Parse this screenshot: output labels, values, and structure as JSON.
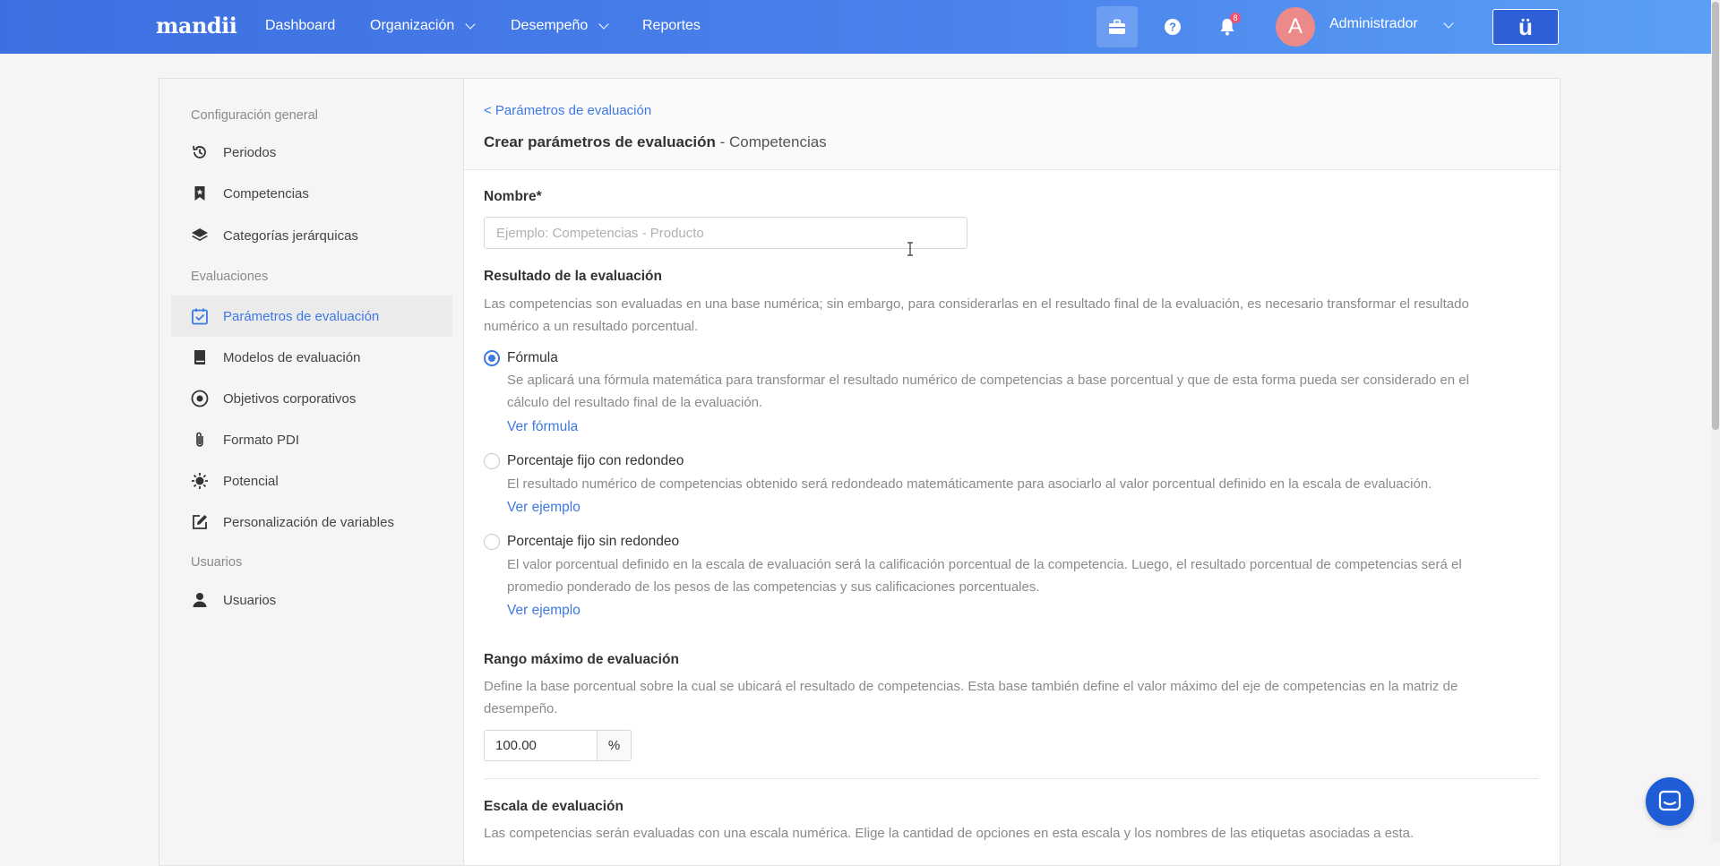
{
  "app": {
    "logo": "mandii",
    "nav": {
      "dashboard": "Dashboard",
      "organizacion": "Organización",
      "desempeno": "Desempeño",
      "reportes": "Reportes"
    },
    "notifications_count": "8",
    "user": {
      "initial": "A",
      "name": "Administrador"
    },
    "brand_button": "ü"
  },
  "sidebar": {
    "groups": {
      "general": "Configuración general",
      "evaluaciones": "Evaluaciones",
      "usuarios": "Usuarios"
    },
    "items": [
      {
        "label": "Periodos",
        "icon": "history-icon"
      },
      {
        "label": "Competencias",
        "icon": "bookmark-icon"
      },
      {
        "label": "Categorías jerárquicas",
        "icon": "layers-icon"
      },
      {
        "label": "Parámetros de evaluación",
        "icon": "calendar-check-icon",
        "active": true
      },
      {
        "label": "Modelos de evaluación",
        "icon": "book-icon"
      },
      {
        "label": "Objetivos corporativos",
        "icon": "target-icon"
      },
      {
        "label": "Formato PDI",
        "icon": "paperclip-icon"
      },
      {
        "label": "Potencial",
        "icon": "sun-icon"
      },
      {
        "label": "Personalización de variables",
        "icon": "edit-icon"
      },
      {
        "label": "Usuarios",
        "icon": "user-icon"
      }
    ]
  },
  "header": {
    "back_link": "< Parámetros de evaluación",
    "title_bold": "Crear parámetros de evaluación",
    "title_rest": " - Competencias"
  },
  "form": {
    "nombre_label": "Nombre*",
    "nombre_placeholder": "Ejemplo: Competencias - Producto",
    "nombre_value": "",
    "resultado_label": "Resultado de la evaluación",
    "resultado_desc": "Las competencias son evaluadas en una base numérica; sin embargo, para considerarlas en el resultado final de la evaluación, es necesario transformar el resultado numérico a un resultado porcentual.",
    "options": [
      {
        "label": "Fórmula",
        "desc": "Se aplicará una fórmula matemática para transformar el resultado numérico de competencias a base porcentual y que de esta forma pueda ser considerado en el cálculo del resultado final de la evaluación.",
        "link": "Ver fórmula",
        "selected": true
      },
      {
        "label": "Porcentaje fijo con redondeo",
        "desc": "El resultado numérico de competencias obtenido será redondeado matemáticamente para asociarlo al valor porcentual definido en la escala de evaluación.",
        "link": "Ver ejemplo",
        "selected": false
      },
      {
        "label": "Porcentaje fijo sin redondeo",
        "desc": "El valor porcentual definido en la escala de evaluación será la calificación porcentual de la competencia. Luego, el resultado porcentual de competencias será el promedio ponderado de los pesos de las competencias y sus calificaciones porcentuales.",
        "link": "Ver ejemplo",
        "selected": false
      }
    ],
    "rango_label": "Rango máximo de evaluación",
    "rango_desc": "Define la base porcentual sobre la cual se ubicará el resultado de competencias. Esta base también define el valor máximo del eje de competencias en la matriz de desempeño.",
    "rango_value": "100.00",
    "rango_unit": "%",
    "escala_label": "Escala de evaluación",
    "escala_desc": "Las competencias serán evaluadas con una escala numérica. Elige la cantidad de opciones en esta escala y los nombres de las etiquetas asociadas a esta."
  },
  "colors": {
    "accent": "#3d78e3",
    "topbar_start": "#3d6fe0",
    "topbar_end": "#5aa0f5",
    "chat": "#1f5dd6"
  }
}
